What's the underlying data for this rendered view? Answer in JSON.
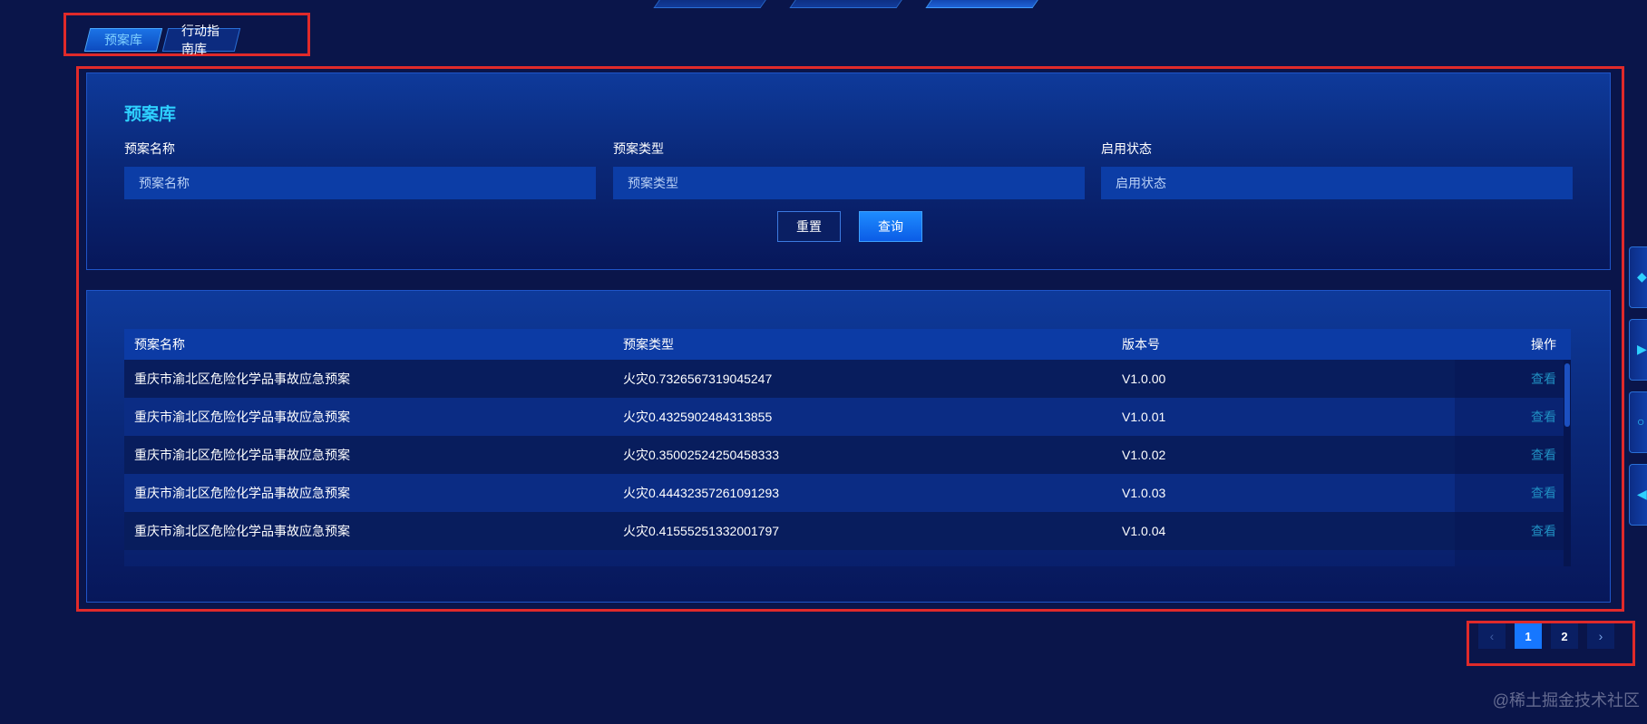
{
  "tabs": [
    {
      "label": "预案库",
      "active": true
    },
    {
      "label": "行动指南库",
      "active": false
    }
  ],
  "search_panel": {
    "title": "预案库",
    "fields": [
      {
        "label": "预案名称",
        "placeholder": "预案名称"
      },
      {
        "label": "预案类型",
        "placeholder": "预案类型"
      },
      {
        "label": "启用状态",
        "placeholder": "启用状态"
      }
    ],
    "reset_label": "重置",
    "query_label": "查询"
  },
  "table": {
    "columns": [
      "预案名称",
      "预案类型",
      "版本号",
      "操作"
    ],
    "rows": [
      {
        "name": "重庆市渝北区危险化学品事故应急预案",
        "type": "火灾0.7326567319045247",
        "version": "V1.0.00",
        "action": "查看"
      },
      {
        "name": "重庆市渝北区危险化学品事故应急预案",
        "type": "火灾0.4325902484313855",
        "version": "V1.0.01",
        "action": "查看"
      },
      {
        "name": "重庆市渝北区危险化学品事故应急预案",
        "type": "火灾0.35002524250458333",
        "version": "V1.0.02",
        "action": "查看"
      },
      {
        "name": "重庆市渝北区危险化学品事故应急预案",
        "type": "火灾0.44432357261091293",
        "version": "V1.0.03",
        "action": "查看"
      },
      {
        "name": "重庆市渝北区危险化学品事故应急预案",
        "type": "火灾0.41555251332001797",
        "version": "V1.0.04",
        "action": "查看"
      }
    ]
  },
  "pagination": {
    "prev_icon": "chevron-left-icon",
    "next_icon": "chevron-right-icon",
    "pages": [
      "1",
      "2"
    ],
    "current": "1"
  },
  "watermark": "@稀土掘金技术社区",
  "colors": {
    "background": "#0a154a",
    "accent": "#2ed1ff",
    "primary_button": "#1677ff",
    "annotation_red": "#e02a2a"
  }
}
